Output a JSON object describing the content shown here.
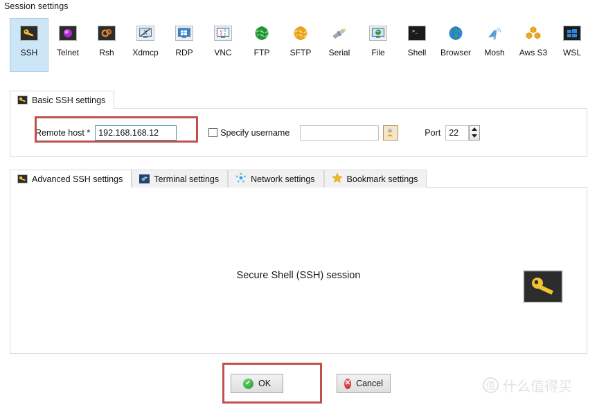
{
  "window": {
    "title": "Session settings"
  },
  "session_types": [
    {
      "label": "SSH",
      "icon": "ssh-key-icon",
      "selected": true
    },
    {
      "label": "Telnet",
      "icon": "telnet-icon",
      "selected": false
    },
    {
      "label": "Rsh",
      "icon": "rsh-icon",
      "selected": false
    },
    {
      "label": "Xdmcp",
      "icon": "xdmcp-icon",
      "selected": false
    },
    {
      "label": "RDP",
      "icon": "rdp-icon",
      "selected": false
    },
    {
      "label": "VNC",
      "icon": "vnc-icon",
      "selected": false
    },
    {
      "label": "FTP",
      "icon": "ftp-globe-icon",
      "selected": false
    },
    {
      "label": "SFTP",
      "icon": "sftp-globe-icon",
      "selected": false
    },
    {
      "label": "Serial",
      "icon": "serial-plug-icon",
      "selected": false
    },
    {
      "label": "File",
      "icon": "file-monitor-icon",
      "selected": false
    },
    {
      "label": "Shell",
      "icon": "shell-console-icon",
      "selected": false
    },
    {
      "label": "Browser",
      "icon": "browser-globe-icon",
      "selected": false
    },
    {
      "label": "Mosh",
      "icon": "mosh-dish-icon",
      "selected": false
    },
    {
      "label": "Aws S3",
      "icon": "aws-s3-icon",
      "selected": false
    },
    {
      "label": "WSL",
      "icon": "wsl-windows-icon",
      "selected": false
    }
  ],
  "basic_tab": {
    "label": "Basic SSH settings",
    "icon": "key-icon",
    "remote_host": {
      "label": "Remote host *",
      "value": "192.168.168.12",
      "placeholder": ""
    },
    "specify_username": {
      "label": "Specify username",
      "checked": false,
      "value": "",
      "placeholder": "",
      "picker_icon": "user-picker-icon"
    },
    "port": {
      "label": "Port",
      "value": "22",
      "spinner_up_icon": "spinner-up-icon",
      "spinner_down_icon": "spinner-down-icon"
    }
  },
  "lower_tabs": [
    {
      "label": "Advanced SSH settings",
      "icon": "key-icon",
      "active": true
    },
    {
      "label": "Terminal settings",
      "icon": "terminal-icon",
      "active": false
    },
    {
      "label": "Network settings",
      "icon": "network-icon",
      "active": false
    },
    {
      "label": "Bookmark settings",
      "icon": "star-icon",
      "active": false
    }
  ],
  "main_panel": {
    "caption": "Secure Shell (SSH) session",
    "badge_icon": "large-key-icon"
  },
  "footer": {
    "ok_label": "OK",
    "ok_icon": "check-circle-icon",
    "cancel_label": "Cancel",
    "cancel_icon": "x-circle-icon"
  },
  "watermark": {
    "mark": "值",
    "text": "什么值得买"
  },
  "colors": {
    "selection_blue": "#cde6f7",
    "highlight_red": "#c0504d",
    "focus_border": "#4f9ba6",
    "ok_green": "#1e9b2b",
    "cancel_red": "#c41f1f"
  }
}
